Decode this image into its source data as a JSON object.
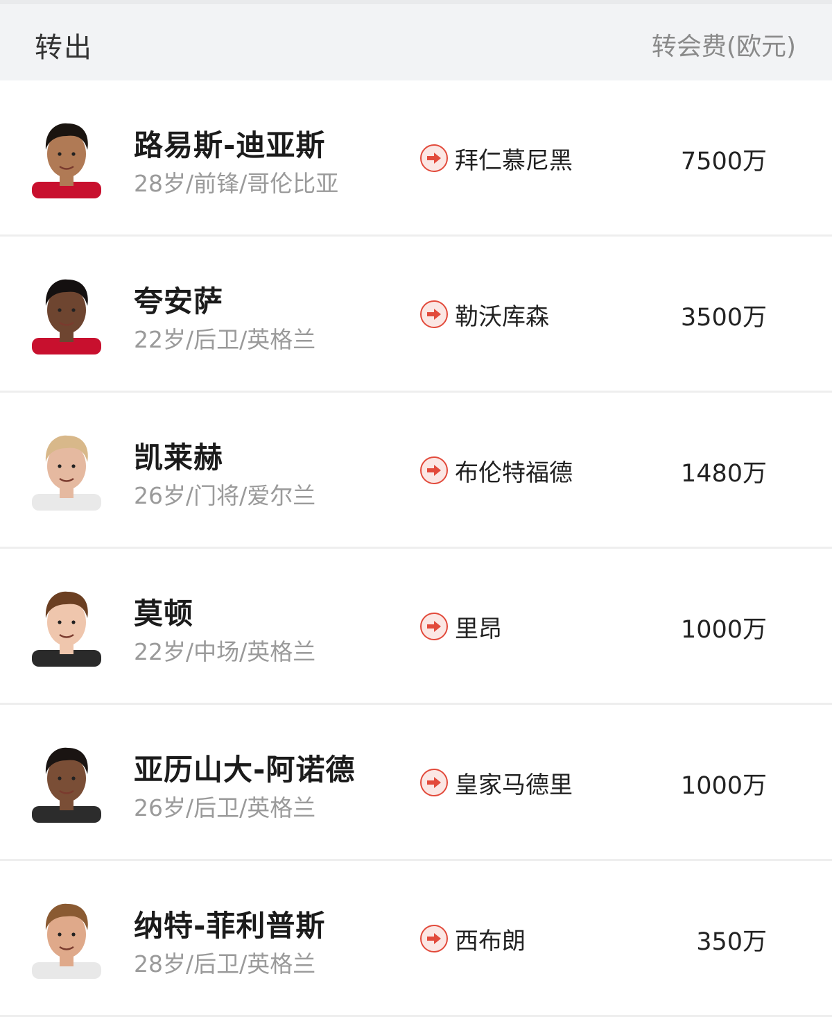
{
  "header": {
    "title": "转出",
    "fee_label": "转会费(欧元)"
  },
  "players": [
    {
      "name": "路易斯-迪亚斯",
      "meta": "28岁/前锋/哥伦比亚",
      "destination": "拜仁慕尼黑",
      "fee": "7500万",
      "skin": "#b07a55",
      "hair": "#1a1410",
      "shirt": "#c8102e"
    },
    {
      "name": "夸安萨",
      "meta": "22岁/后卫/英格兰",
      "destination": "勒沃库森",
      "fee": "3500万",
      "skin": "#6e4530",
      "hair": "#141010",
      "shirt": "#c8102e"
    },
    {
      "name": "凯莱赫",
      "meta": "26岁/门将/爱尔兰",
      "destination": "布伦特福德",
      "fee": "1480万",
      "skin": "#e5b9a0",
      "hair": "#d8b88a",
      "shirt": "#e9e9e9"
    },
    {
      "name": "莫顿",
      "meta": "22岁/中场/英格兰",
      "destination": "里昂",
      "fee": "1000万",
      "skin": "#efc6ad",
      "hair": "#6b3f22",
      "shirt": "#2a2a2a"
    },
    {
      "name": "亚历山大-阿诺德",
      "meta": "26岁/后卫/英格兰",
      "destination": "皇家马德里",
      "fee": "1000万",
      "skin": "#7a4e36",
      "hair": "#1a1412",
      "shirt": "#2c2c2c"
    },
    {
      "name": "纳特-菲利普斯",
      "meta": "28岁/后卫/英格兰",
      "destination": "西布朗",
      "fee": "350万",
      "skin": "#dfa98a",
      "hair": "#8a5a32",
      "shirt": "#e8e8e8"
    }
  ],
  "icons": {
    "transfer": "arrow-right-circle-icon"
  },
  "colors": {
    "accent": "#e24a3b",
    "header_bg": "#f2f3f5",
    "meta_text": "#9a9a9a"
  }
}
